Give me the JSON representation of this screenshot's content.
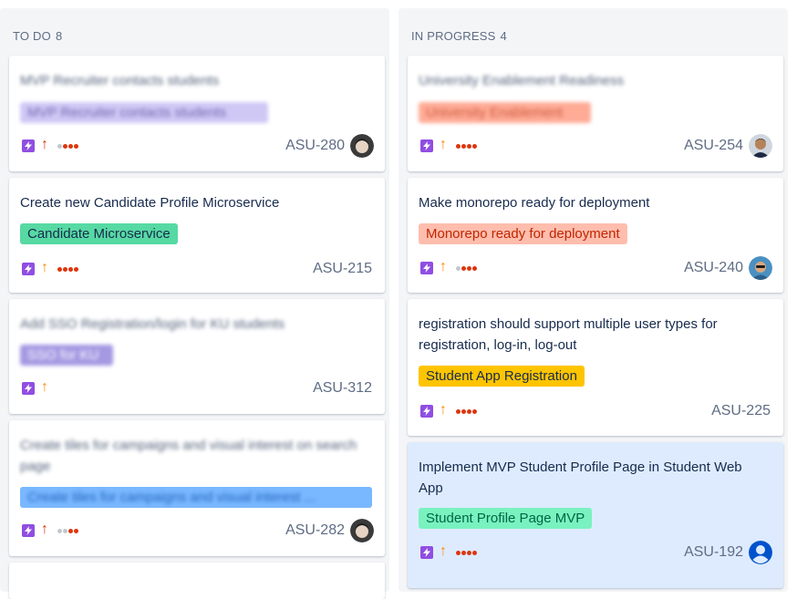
{
  "columns": [
    {
      "title": "TO DO",
      "count": "8",
      "cards": [
        {
          "title": "MVP Recruiter contacts students",
          "epic": "MVP Recruiter contacts students",
          "key": "ASU-280",
          "blurred": true
        },
        {
          "title": "Create new Candidate Profile Microservice",
          "epic": "Candidate Microservice",
          "key": "ASU-215",
          "blurred": false
        },
        {
          "title": "Add SSO Registration/login for KU students",
          "epic": "SSO for KU",
          "key": "ASU-312",
          "blurred": true
        },
        {
          "title": "Create tiles for campaigns and visual interest on search page",
          "epic": "Create tiles for campaigns and visual interest ...",
          "key": "ASU-282",
          "blurred": true
        }
      ]
    },
    {
      "title": "IN PROGRESS",
      "count": "4",
      "cards": [
        {
          "title": "University Enablement Readiness",
          "epic": "University Enablement",
          "key": "ASU-254",
          "blurred": true
        },
        {
          "title": "Make monorepo ready for deployment",
          "epic": "Monorepo ready for deployment",
          "key": "ASU-240",
          "blurred": false
        },
        {
          "title": "registration should support multiple user types for registration, log-in, log-out",
          "epic": "Student App Registration",
          "key": "ASU-225",
          "blurred": false
        },
        {
          "title": "Implement MVP Student Profile Page in Student Web App",
          "epic": "Student Profile Page MVP",
          "key": "ASU-192",
          "blurred": false
        }
      ]
    }
  ],
  "colors": {
    "priority_high": "#de350b",
    "priority_medium": "#ff8b00",
    "story_purple": "#904ee2",
    "epic_purple_light": "#c0b6f2",
    "epic_green": "#57d9a3",
    "epic_purple": "#8777d9",
    "epic_blue": "#79b8ff",
    "epic_salmon": "#ff8f73",
    "epic_peach": "#ffbdad",
    "epic_yellow": "#ffc400",
    "epic_mint": "#79f2c0",
    "selected_card": "#deebff"
  },
  "icons": {
    "issue_type": "story-lightning-icon",
    "priority_up": "arrow-up-icon",
    "estimate": "dots-icon"
  }
}
